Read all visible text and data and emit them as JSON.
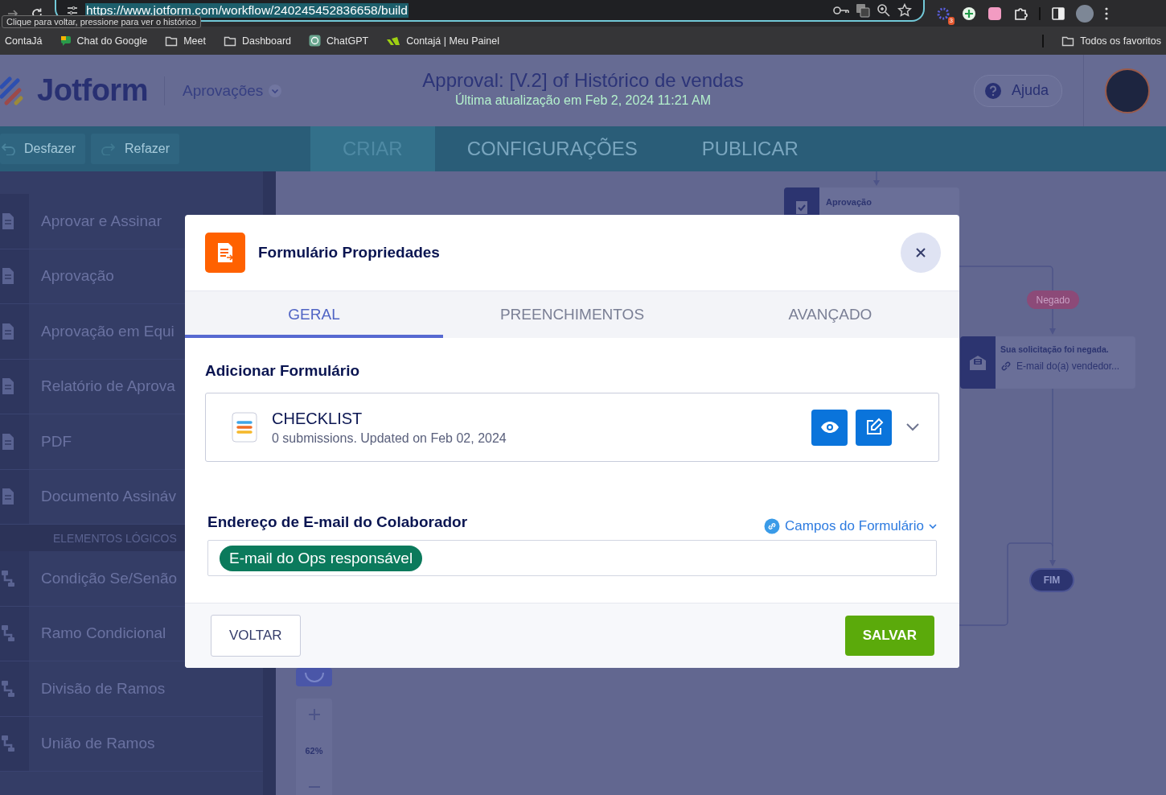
{
  "browser": {
    "url": "https://www.jotform.com/workflow/240245452836658/build",
    "tooltip": "Clique para voltar, pressione para ver o histórico",
    "extension_badge": "3",
    "bookmarks": [
      {
        "label": "ContaJá",
        "kind": "plain"
      },
      {
        "label": "Chat do Google",
        "kind": "chat"
      },
      {
        "label": "Meet",
        "kind": "folder"
      },
      {
        "label": "Dashboard",
        "kind": "folder"
      },
      {
        "label": "ChatGPT",
        "kind": "gpt"
      },
      {
        "label": "Contajá | Meu Painel",
        "kind": "app"
      }
    ],
    "all_bookmarks": "Todos os favoritos"
  },
  "header": {
    "logo": "Jotform",
    "section": "Aprovações",
    "title": "Approval: [V.2] of Histórico de vendas",
    "subtitle": "Última atualização em Feb 2, 2024 11:21 AM",
    "help": "Ajuda"
  },
  "toolbar": {
    "undo": "Desfazer",
    "redo": "Refazer",
    "tabs": [
      {
        "label": "CRIAR",
        "selected": true
      },
      {
        "label": "CONFIGURAÇÕES",
        "selected": false
      },
      {
        "label": "PUBLICAR",
        "selected": false
      }
    ]
  },
  "sidebar": {
    "items": [
      {
        "kind": "item",
        "label": "Aprovar e Assinar"
      },
      {
        "kind": "item",
        "label": "Aprovação"
      },
      {
        "kind": "item",
        "label": "Aprovação em Equi"
      },
      {
        "kind": "item",
        "label": "Relatório de Aprova"
      },
      {
        "kind": "item",
        "label": "PDF"
      },
      {
        "kind": "item",
        "label": "Documento Assináv"
      },
      {
        "kind": "section",
        "label": "ELEMENTOS LÓGICOS"
      },
      {
        "kind": "logic",
        "label": "Condição Se/Senão"
      },
      {
        "kind": "logic",
        "label": "Ramo Condicional"
      },
      {
        "kind": "logic",
        "label": "Divisão de Ramos"
      },
      {
        "kind": "logic",
        "label": "União de Ramos"
      }
    ]
  },
  "canvas": {
    "approval_node": "Aprovação",
    "branch_label": "Negado",
    "email_node": {
      "title": "Sua solicitação foi negada.",
      "recipient": "E-mail do(a) vendedor..."
    },
    "end_node": "FIM",
    "zoom": "62%"
  },
  "modal": {
    "title": "Formulário Propriedades",
    "tabs": [
      {
        "label": "GERAL",
        "selected": true
      },
      {
        "label": "PREENCHIMENTOS",
        "selected": false
      },
      {
        "label": "AVANÇADO",
        "selected": false
      }
    ],
    "form_section": "Adicionar Formulário",
    "form": {
      "name": "CHECKLIST",
      "meta": "0 submissions. Updated on Feb 02, 2024"
    },
    "email_label": "Endereço de E-mail do Colaborador",
    "fields_link": "Campos do Formulário",
    "email_tag": "E-mail do Ops responsável",
    "back": "VOLTAR",
    "save": "SALVAR"
  }
}
